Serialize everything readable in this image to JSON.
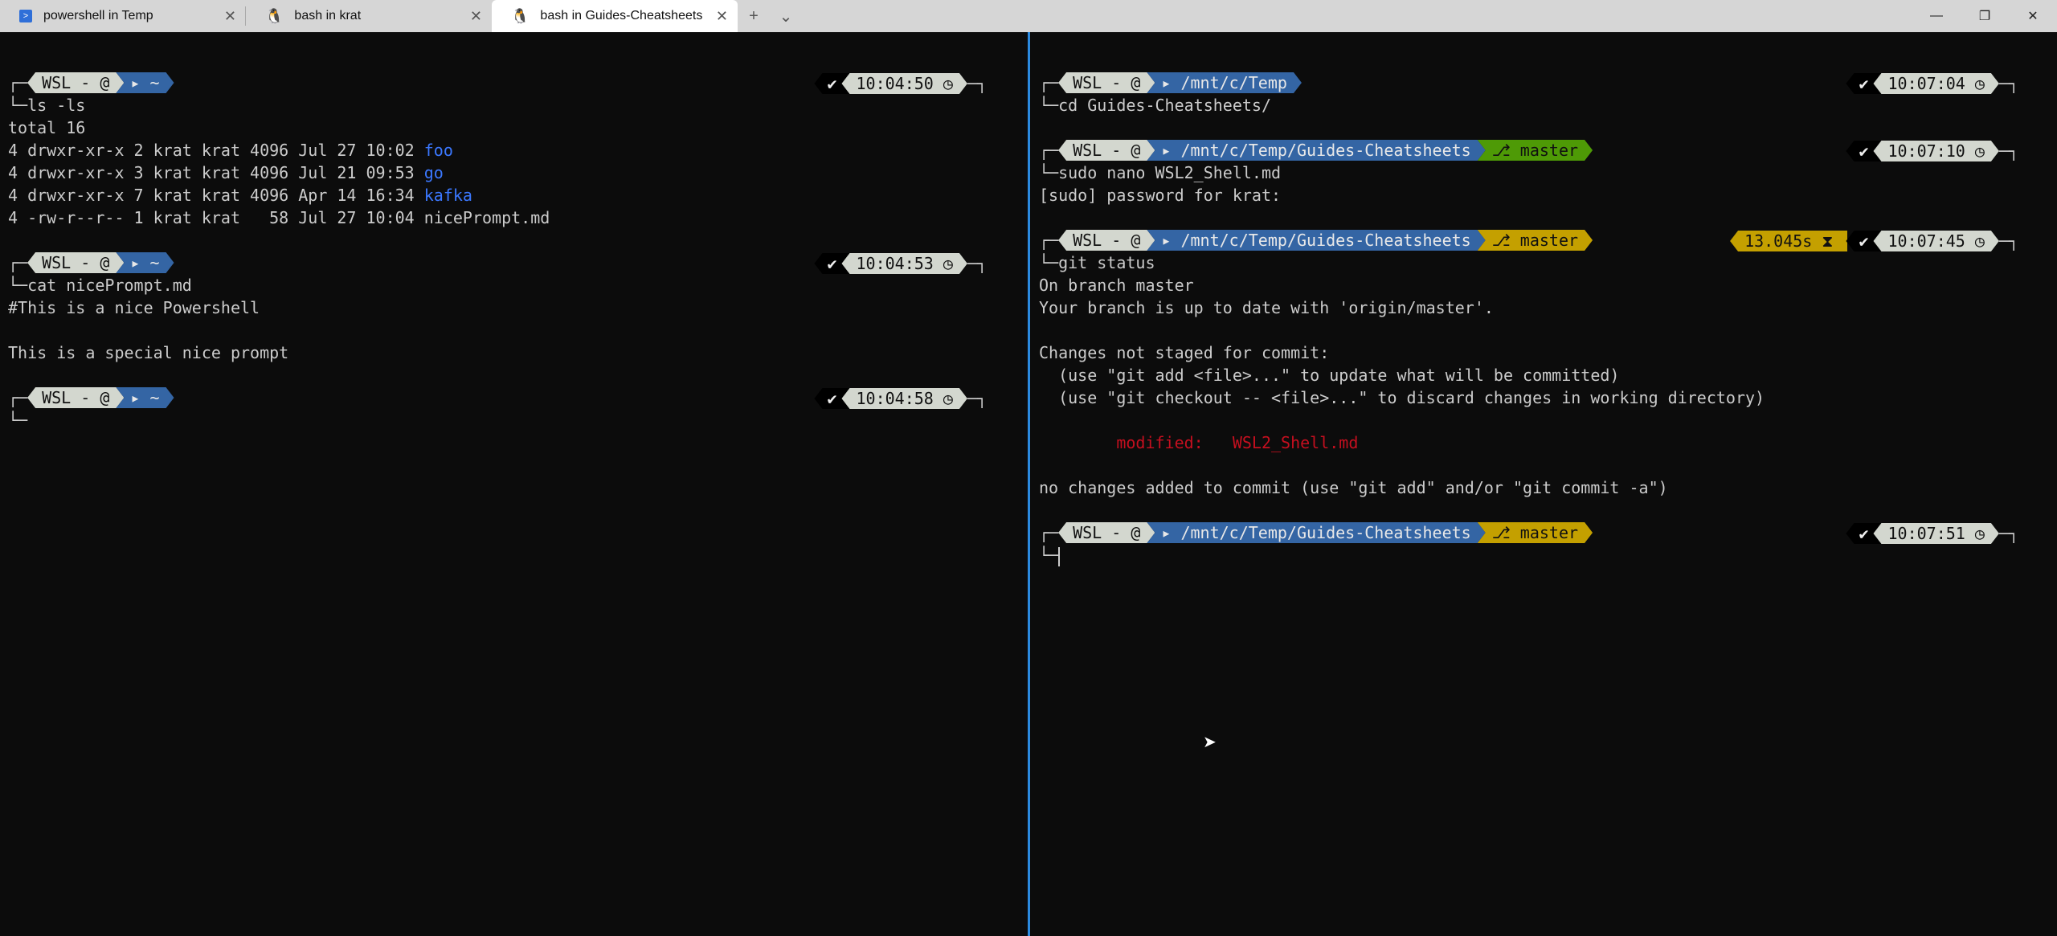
{
  "tabs": [
    {
      "label": "powershell in Temp",
      "icon": "powershell-icon",
      "active": false
    },
    {
      "label": "bash in krat",
      "icon": "linux-tux-icon",
      "active": false
    },
    {
      "label": "bash in Guides-Cheatsheets",
      "icon": "linux-tux-icon",
      "active": true
    }
  ],
  "tabbar": {
    "new_tab": "+",
    "dropdown": "⌄",
    "close": "✕",
    "minimize": "—",
    "maximize": "❐",
    "close_window": "✕"
  },
  "colors": {
    "os_segment": "#d3d7cf",
    "path_segment": "#3465a4",
    "git_clean": "#4e9a06",
    "git_dirty": "#c4a000",
    "directory": "#3b78ff",
    "modified": "#c50f1f",
    "pane_focus": "#2b8ae0"
  },
  "panes": {
    "left": {
      "right_edge": "left",
      "lines": [
        {
          "type": "prompt",
          "os": "WSL - @",
          "path": "▸ ~",
          "time": "10:04:50 ◷"
        },
        {
          "type": "cmd",
          "text": "ls -ls"
        },
        {
          "type": "text",
          "parts": [
            {
              "t": "total 16"
            }
          ]
        },
        {
          "type": "text",
          "parts": [
            {
              "t": "4 drwxr-xr-x 2 krat krat 4096 Jul 27 10:02 "
            },
            {
              "t": "foo",
              "c": "blue"
            }
          ]
        },
        {
          "type": "text",
          "parts": [
            {
              "t": "4 drwxr-xr-x 3 krat krat 4096 Jul 21 09:53 "
            },
            {
              "t": "go",
              "c": "blue"
            }
          ]
        },
        {
          "type": "text",
          "parts": [
            {
              "t": "4 drwxr-xr-x 7 krat krat 4096 Apr 14 16:34 "
            },
            {
              "t": "kafka",
              "c": "blue"
            }
          ]
        },
        {
          "type": "text",
          "parts": [
            {
              "t": "4 -rw-r--r-- 1 krat krat   58 Jul 27 10:04 nicePrompt.md"
            }
          ]
        },
        {
          "type": "blank"
        },
        {
          "type": "prompt",
          "os": "WSL - @",
          "path": "▸ ~",
          "time": "10:04:53 ◷"
        },
        {
          "type": "cmd",
          "text": "cat nicePrompt.md"
        },
        {
          "type": "text",
          "parts": [
            {
              "t": "#This is a nice Powershell"
            }
          ]
        },
        {
          "type": "blank"
        },
        {
          "type": "text",
          "parts": [
            {
              "t": "This is a special nice prompt"
            }
          ]
        },
        {
          "type": "blank"
        },
        {
          "type": "prompt",
          "os": "WSL - @",
          "path": "▸ ~",
          "time": "10:04:58 ◷"
        },
        {
          "type": "cmd",
          "text": "",
          "cursor": false
        }
      ]
    },
    "right": {
      "lines": [
        {
          "type": "prompt",
          "os": "WSL - @",
          "path": "▸ /mnt/c/Temp",
          "time": "10:07:04 ◷"
        },
        {
          "type": "cmd",
          "text": "cd Guides-Cheatsheets/"
        },
        {
          "type": "blank"
        },
        {
          "type": "prompt",
          "os": "WSL - @",
          "path": "▸ /mnt/c/Temp/Guides-Cheatsheets",
          "git": "⎇ master",
          "git_state": "clean",
          "time": "10:07:10 ◷"
        },
        {
          "type": "cmd",
          "text": "sudo nano WSL2_Shell.md"
        },
        {
          "type": "text",
          "parts": [
            {
              "t": "[sudo] password for krat:"
            }
          ]
        },
        {
          "type": "blank"
        },
        {
          "type": "prompt",
          "os": "WSL - @",
          "path": "▸ /mnt/c/Temp/Guides-Cheatsheets",
          "git": "⎇ master",
          "git_state": "dirty",
          "duration": "13.045s ⧗",
          "time": "10:07:45 ◷"
        },
        {
          "type": "cmd",
          "text": "git status"
        },
        {
          "type": "text",
          "parts": [
            {
              "t": "On branch master"
            }
          ]
        },
        {
          "type": "text",
          "parts": [
            {
              "t": "Your branch is up to date with 'origin/master'."
            }
          ]
        },
        {
          "type": "blank"
        },
        {
          "type": "text",
          "parts": [
            {
              "t": "Changes not staged for commit:"
            }
          ]
        },
        {
          "type": "text",
          "parts": [
            {
              "t": "  (use \"git add <file>...\" to update what will be committed)"
            }
          ]
        },
        {
          "type": "text",
          "parts": [
            {
              "t": "  (use \"git checkout -- <file>...\" to discard changes in working directory)"
            }
          ]
        },
        {
          "type": "blank"
        },
        {
          "type": "text",
          "parts": [
            {
              "t": "        modified:   WSL2_Shell.md",
              "c": "red"
            }
          ]
        },
        {
          "type": "blank"
        },
        {
          "type": "text",
          "parts": [
            {
              "t": "no changes added to commit (use \"git add\" and/or \"git commit -a\")"
            }
          ]
        },
        {
          "type": "blank"
        },
        {
          "type": "prompt",
          "os": "WSL - @",
          "path": "▸ /mnt/c/Temp/Guides-Cheatsheets",
          "git": "⎇ master",
          "git_state": "dirty",
          "time": "10:07:51 ◷"
        },
        {
          "type": "cmd",
          "text": "",
          "cursor": true
        }
      ]
    }
  },
  "check": "✔"
}
